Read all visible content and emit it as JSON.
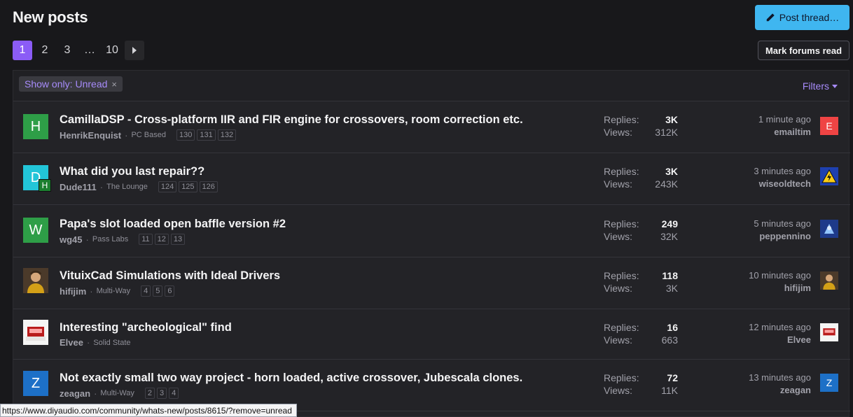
{
  "header": {
    "title": "New posts",
    "post_thread_label": "Post thread…",
    "mark_read_label": "Mark forums read",
    "post_button_color": "#3fb6f0"
  },
  "pagination": {
    "pages": [
      "1",
      "2",
      "3",
      "…",
      "10"
    ],
    "current": "1",
    "next_icon": "chevron-right-icon"
  },
  "filters": {
    "show_only_label": "Show only:",
    "show_only_value": "Unread",
    "remove_symbol": "×",
    "filters_label": "Filters",
    "accent_color": "#a78bfa"
  },
  "threads": [
    {
      "title": "CamillaDSP - Cross-platform IIR and FIR engine for crossovers, room correction etc.",
      "author": "HenrikEnquist",
      "forum": "PC Based",
      "pages": [
        "130",
        "131",
        "132"
      ],
      "avatar_letter": "H",
      "avatar_color": "#2e9e47",
      "replies_label": "Replies:",
      "replies": "3K",
      "views_label": "Views:",
      "views": "312K",
      "last_time": "1 minute ago",
      "last_user": "emailtim",
      "last_avatar_letter": "E",
      "last_avatar_color": "#ef4444"
    },
    {
      "title": "What did you last repair??",
      "author": "Dude111",
      "forum": "The Lounge",
      "pages": [
        "124",
        "125",
        "126"
      ],
      "avatar_letter": "D",
      "avatar_color": "#22c5d8",
      "avatar_badge": "H",
      "replies_label": "Replies:",
      "replies": "3K",
      "views_label": "Views:",
      "views": "243K",
      "last_time": "3 minutes ago",
      "last_user": "wiseoldtech",
      "last_avatar_icon": "warning-triangle-icon"
    },
    {
      "title": "Papa's slot loaded open baffle version #2",
      "author": "wg45",
      "forum": "Pass Labs",
      "pages": [
        "11",
        "12",
        "13"
      ],
      "avatar_letter": "W",
      "avatar_color": "#2e9e47",
      "replies_label": "Replies:",
      "replies": "249",
      "views_label": "Views:",
      "views": "32K",
      "last_time": "5 minutes ago",
      "last_user": "peppennino",
      "last_avatar_icon": "photo-avatar-icon"
    },
    {
      "title": "VituixCad Simulations with Ideal Drivers",
      "author": "hifijim",
      "forum": "Multi-Way",
      "pages": [
        "4",
        "5",
        "6"
      ],
      "avatar_icon": "photo-avatar-icon",
      "replies_label": "Replies:",
      "replies": "118",
      "views_label": "Views:",
      "views": "3K",
      "last_time": "10 minutes ago",
      "last_user": "hifijim",
      "last_avatar_icon": "photo-avatar-icon"
    },
    {
      "title": "Interesting \"archeological\" find",
      "author": "Elvee",
      "forum": "Solid State",
      "pages": [],
      "avatar_icon": "photo-avatar-icon",
      "replies_label": "Replies:",
      "replies": "16",
      "views_label": "Views:",
      "views": "663",
      "last_time": "12 minutes ago",
      "last_user": "Elvee",
      "last_avatar_icon": "photo-avatar-icon"
    },
    {
      "title": "Not exactly small two way project - horn loaded, active crossover, Jubescala clones.",
      "author": "zeagan",
      "forum": "Multi-Way",
      "pages": [
        "2",
        "3",
        "4"
      ],
      "avatar_letter": "Z",
      "avatar_color": "#1d70c7",
      "replies_label": "Replies:",
      "replies": "72",
      "views_label": "Views:",
      "views": "11K",
      "last_time": "13 minutes ago",
      "last_user": "zeagan",
      "last_avatar_letter": "Z",
      "last_avatar_color": "#1d70c7"
    }
  ],
  "status_url": "https://www.diyaudio.com/community/whats-new/posts/8615/?remove=unread"
}
